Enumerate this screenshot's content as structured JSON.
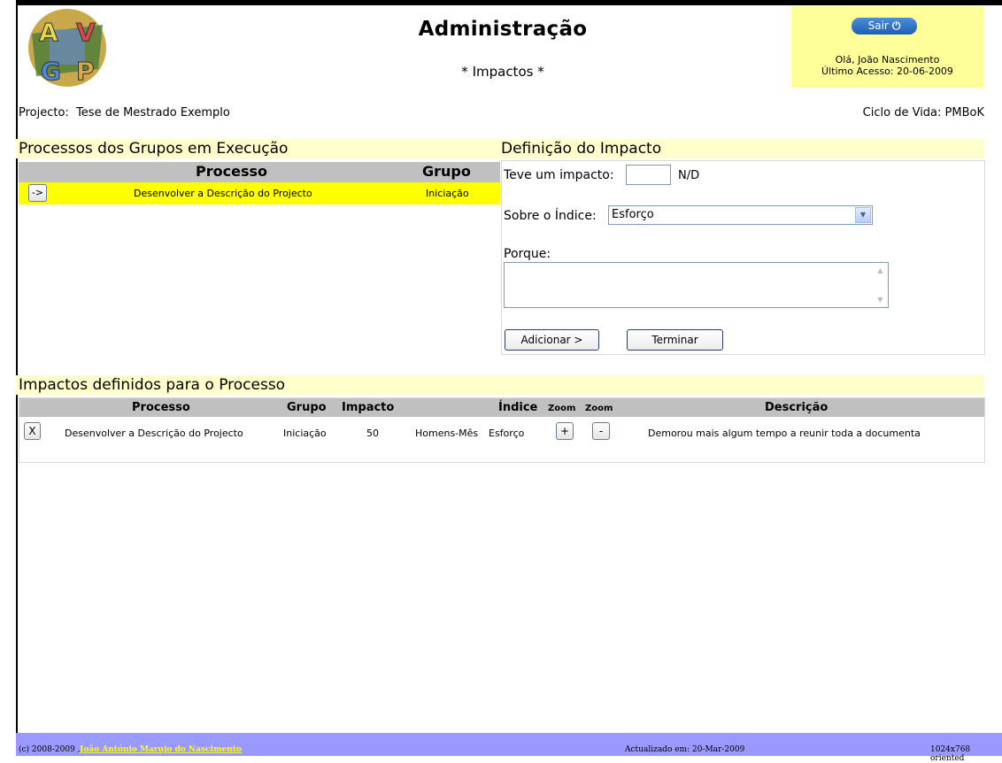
{
  "header": {
    "title": "Administração",
    "subtitle": "* Impactos *",
    "logout_label": "Sair",
    "greeting": "Olá, João Nascimento",
    "last_access": "Último Acesso: 20-06-2009"
  },
  "project": {
    "label": "Projecto:",
    "name": "Tese de Mestrado Exemplo",
    "lifecycle_label": "Ciclo de Vida:",
    "lifecycle": "PMBoK"
  },
  "processes_panel": {
    "title": "Processos dos Grupos em Execução",
    "col_process": "Processo",
    "col_group": "Grupo",
    "rows": [
      {
        "button": "->",
        "process": "Desenvolver a Descrição do Projecto",
        "group": "Iniciação"
      }
    ]
  },
  "impact_definition": {
    "title": "Definição do Impacto",
    "had_impact_label": "Teve um impacto:",
    "had_impact_value": "",
    "unit": "N/D",
    "index_label": "Sobre o Índice:",
    "index_selected": "Esforço",
    "reason_label": "Porque:",
    "reason_value": "",
    "add_button": "Adicionar >",
    "finish_button": "Terminar"
  },
  "impacts_table": {
    "title": "Impactos definidos para o Processo",
    "headers": {
      "process": "Processo",
      "group": "Grupo",
      "impact": "Impacto",
      "index": "Índice",
      "zoom1": "Zoom",
      "zoom2": "Zoom",
      "description": "Descrição"
    },
    "rows": [
      {
        "delete": "X",
        "process": "Desenvolver a Descrição do Projecto",
        "group": "Iniciação",
        "impact": "50",
        "unit": "Homens-Mês",
        "index": "Esforço",
        "zoom_in": "+",
        "zoom_out": "-",
        "description": "Demorou mais algum tempo a reunir toda a documenta"
      }
    ]
  },
  "footer": {
    "copyright": "(c) 2008-2009 ,",
    "author": "João António Marujo do Nascimento",
    "updated": "Actualizado em: 20-Mar-2009",
    "resolution": "1024x768 oriented"
  }
}
